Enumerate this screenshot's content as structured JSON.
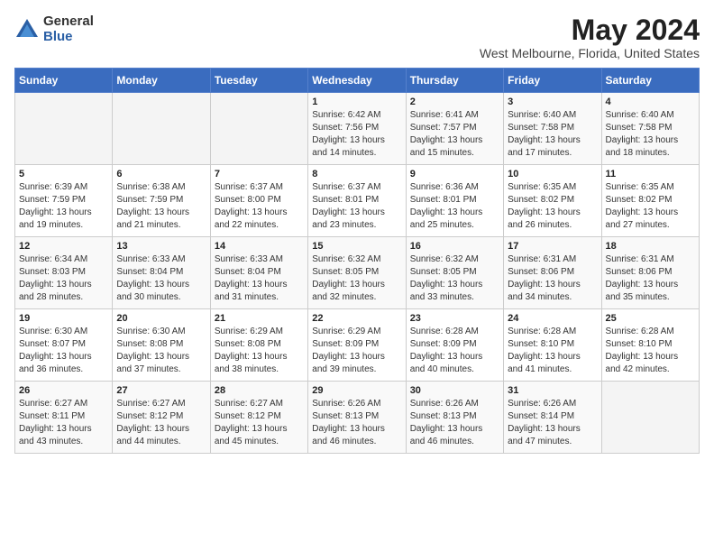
{
  "logo": {
    "general": "General",
    "blue": "Blue"
  },
  "title": "May 2024",
  "location": "West Melbourne, Florida, United States",
  "days_of_week": [
    "Sunday",
    "Monday",
    "Tuesday",
    "Wednesday",
    "Thursday",
    "Friday",
    "Saturday"
  ],
  "weeks": [
    [
      {
        "day": "",
        "info": ""
      },
      {
        "day": "",
        "info": ""
      },
      {
        "day": "",
        "info": ""
      },
      {
        "day": "1",
        "info": "Sunrise: 6:42 AM\nSunset: 7:56 PM\nDaylight: 13 hours\nand 14 minutes."
      },
      {
        "day": "2",
        "info": "Sunrise: 6:41 AM\nSunset: 7:57 PM\nDaylight: 13 hours\nand 15 minutes."
      },
      {
        "day": "3",
        "info": "Sunrise: 6:40 AM\nSunset: 7:58 PM\nDaylight: 13 hours\nand 17 minutes."
      },
      {
        "day": "4",
        "info": "Sunrise: 6:40 AM\nSunset: 7:58 PM\nDaylight: 13 hours\nand 18 minutes."
      }
    ],
    [
      {
        "day": "5",
        "info": "Sunrise: 6:39 AM\nSunset: 7:59 PM\nDaylight: 13 hours\nand 19 minutes."
      },
      {
        "day": "6",
        "info": "Sunrise: 6:38 AM\nSunset: 7:59 PM\nDaylight: 13 hours\nand 21 minutes."
      },
      {
        "day": "7",
        "info": "Sunrise: 6:37 AM\nSunset: 8:00 PM\nDaylight: 13 hours\nand 22 minutes."
      },
      {
        "day": "8",
        "info": "Sunrise: 6:37 AM\nSunset: 8:01 PM\nDaylight: 13 hours\nand 23 minutes."
      },
      {
        "day": "9",
        "info": "Sunrise: 6:36 AM\nSunset: 8:01 PM\nDaylight: 13 hours\nand 25 minutes."
      },
      {
        "day": "10",
        "info": "Sunrise: 6:35 AM\nSunset: 8:02 PM\nDaylight: 13 hours\nand 26 minutes."
      },
      {
        "day": "11",
        "info": "Sunrise: 6:35 AM\nSunset: 8:02 PM\nDaylight: 13 hours\nand 27 minutes."
      }
    ],
    [
      {
        "day": "12",
        "info": "Sunrise: 6:34 AM\nSunset: 8:03 PM\nDaylight: 13 hours\nand 28 minutes."
      },
      {
        "day": "13",
        "info": "Sunrise: 6:33 AM\nSunset: 8:04 PM\nDaylight: 13 hours\nand 30 minutes."
      },
      {
        "day": "14",
        "info": "Sunrise: 6:33 AM\nSunset: 8:04 PM\nDaylight: 13 hours\nand 31 minutes."
      },
      {
        "day": "15",
        "info": "Sunrise: 6:32 AM\nSunset: 8:05 PM\nDaylight: 13 hours\nand 32 minutes."
      },
      {
        "day": "16",
        "info": "Sunrise: 6:32 AM\nSunset: 8:05 PM\nDaylight: 13 hours\nand 33 minutes."
      },
      {
        "day": "17",
        "info": "Sunrise: 6:31 AM\nSunset: 8:06 PM\nDaylight: 13 hours\nand 34 minutes."
      },
      {
        "day": "18",
        "info": "Sunrise: 6:31 AM\nSunset: 8:06 PM\nDaylight: 13 hours\nand 35 minutes."
      }
    ],
    [
      {
        "day": "19",
        "info": "Sunrise: 6:30 AM\nSunset: 8:07 PM\nDaylight: 13 hours\nand 36 minutes."
      },
      {
        "day": "20",
        "info": "Sunrise: 6:30 AM\nSunset: 8:08 PM\nDaylight: 13 hours\nand 37 minutes."
      },
      {
        "day": "21",
        "info": "Sunrise: 6:29 AM\nSunset: 8:08 PM\nDaylight: 13 hours\nand 38 minutes."
      },
      {
        "day": "22",
        "info": "Sunrise: 6:29 AM\nSunset: 8:09 PM\nDaylight: 13 hours\nand 39 minutes."
      },
      {
        "day": "23",
        "info": "Sunrise: 6:28 AM\nSunset: 8:09 PM\nDaylight: 13 hours\nand 40 minutes."
      },
      {
        "day": "24",
        "info": "Sunrise: 6:28 AM\nSunset: 8:10 PM\nDaylight: 13 hours\nand 41 minutes."
      },
      {
        "day": "25",
        "info": "Sunrise: 6:28 AM\nSunset: 8:10 PM\nDaylight: 13 hours\nand 42 minutes."
      }
    ],
    [
      {
        "day": "26",
        "info": "Sunrise: 6:27 AM\nSunset: 8:11 PM\nDaylight: 13 hours\nand 43 minutes."
      },
      {
        "day": "27",
        "info": "Sunrise: 6:27 AM\nSunset: 8:12 PM\nDaylight: 13 hours\nand 44 minutes."
      },
      {
        "day": "28",
        "info": "Sunrise: 6:27 AM\nSunset: 8:12 PM\nDaylight: 13 hours\nand 45 minutes."
      },
      {
        "day": "29",
        "info": "Sunrise: 6:26 AM\nSunset: 8:13 PM\nDaylight: 13 hours\nand 46 minutes."
      },
      {
        "day": "30",
        "info": "Sunrise: 6:26 AM\nSunset: 8:13 PM\nDaylight: 13 hours\nand 46 minutes."
      },
      {
        "day": "31",
        "info": "Sunrise: 6:26 AM\nSunset: 8:14 PM\nDaylight: 13 hours\nand 47 minutes."
      },
      {
        "day": "",
        "info": ""
      }
    ]
  ]
}
